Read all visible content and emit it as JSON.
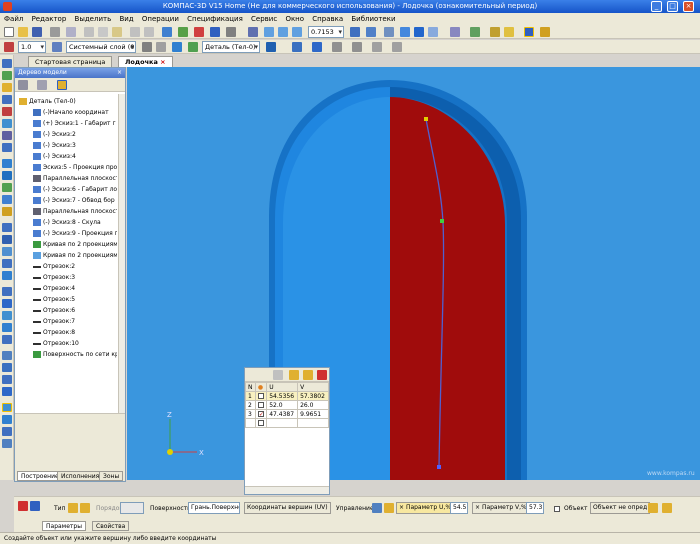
{
  "window": {
    "title": "КОМПАС-3D V15 Home (Не для коммерческого использования) - Лодочка (ознакомительный период)"
  },
  "menu": [
    "Файл",
    "Редактор",
    "Выделить",
    "Вид",
    "Операции",
    "Спецификация",
    "Сервис",
    "Окно",
    "Справка",
    "Библиотеки"
  ],
  "toolbar2": {
    "scale_value": "1.0",
    "layer": "Системный слой (0)",
    "part": "Деталь (Тел-0)",
    "zoom": "0.7153"
  },
  "tabs": [
    {
      "label": "Стартовая страница",
      "active": false
    },
    {
      "label": "Лодочка",
      "active": true
    }
  ],
  "tree": {
    "title": "Дерево модели",
    "root": "Деталь (Тел-0)",
    "items": [
      "(-)Начало координат",
      "(+) Эскиз:1 - Габарит г",
      "(-) Эскиз:2",
      "(-) Эскиз:3",
      "(-) Эскиз:4",
      "Эскиз:5 - Проекция про.",
      "Параллельная плоскост",
      "(-) Эскиз:6 - Габарит ло",
      "(-) Эскиз:7 - Обвод бор",
      "Параллельная плоскост",
      "(-) Эскиз:8 - Скула",
      "(-) Эскиз:9 - Проекция г",
      "Кривая по 2 проекциям:",
      "Кривая по 2 проекциям:",
      "Отрезок:2",
      "Отрезок:3",
      "Отрезок:4",
      "Отрезок:5",
      "Отрезок:6",
      "Отрезок:7",
      "Отрезок:8",
      "Отрезок:10",
      "Поверхность по сети кр"
    ],
    "bottom_tabs": [
      "Построение",
      "Исполнения",
      "Зоны"
    ]
  },
  "uv_table": {
    "headers": [
      "N",
      "",
      "U",
      "V"
    ],
    "rows": [
      {
        "n": "1",
        "checked": false,
        "u": "54.5356",
        "v": "57.3802"
      },
      {
        "n": "2",
        "checked": false,
        "u": "52.0",
        "v": "26.0"
      },
      {
        "n": "3",
        "checked": true,
        "u": "47.4387",
        "v": "9.9651"
      }
    ]
  },
  "axes": {
    "x": "X",
    "z": "Z"
  },
  "propbar": {
    "type_label": "Тип",
    "order_label": "Порядок",
    "surface_label": "Поверхность",
    "surface_value": "Грань.Поверхнос",
    "coords_button": "Координаты вершин (UV)",
    "control_label": "Управление",
    "param_u_label": "Параметр U,%",
    "param_u_value": "54.5",
    "param_v_label": "Параметр V,%",
    "param_v_value": "57.3",
    "object_label": "Объект",
    "object_value": "Объект не опред",
    "tabs": [
      "Параметры",
      "Свойства"
    ]
  },
  "status": "Создайте объект или укажите вершину либо введите координаты",
  "watermark": "www.kompas.ru",
  "colors": {
    "viewport": "#3a96de",
    "hull_blue": "#1f7fd8",
    "hull_red": "#a00c0c",
    "accent": "#1654c8"
  }
}
